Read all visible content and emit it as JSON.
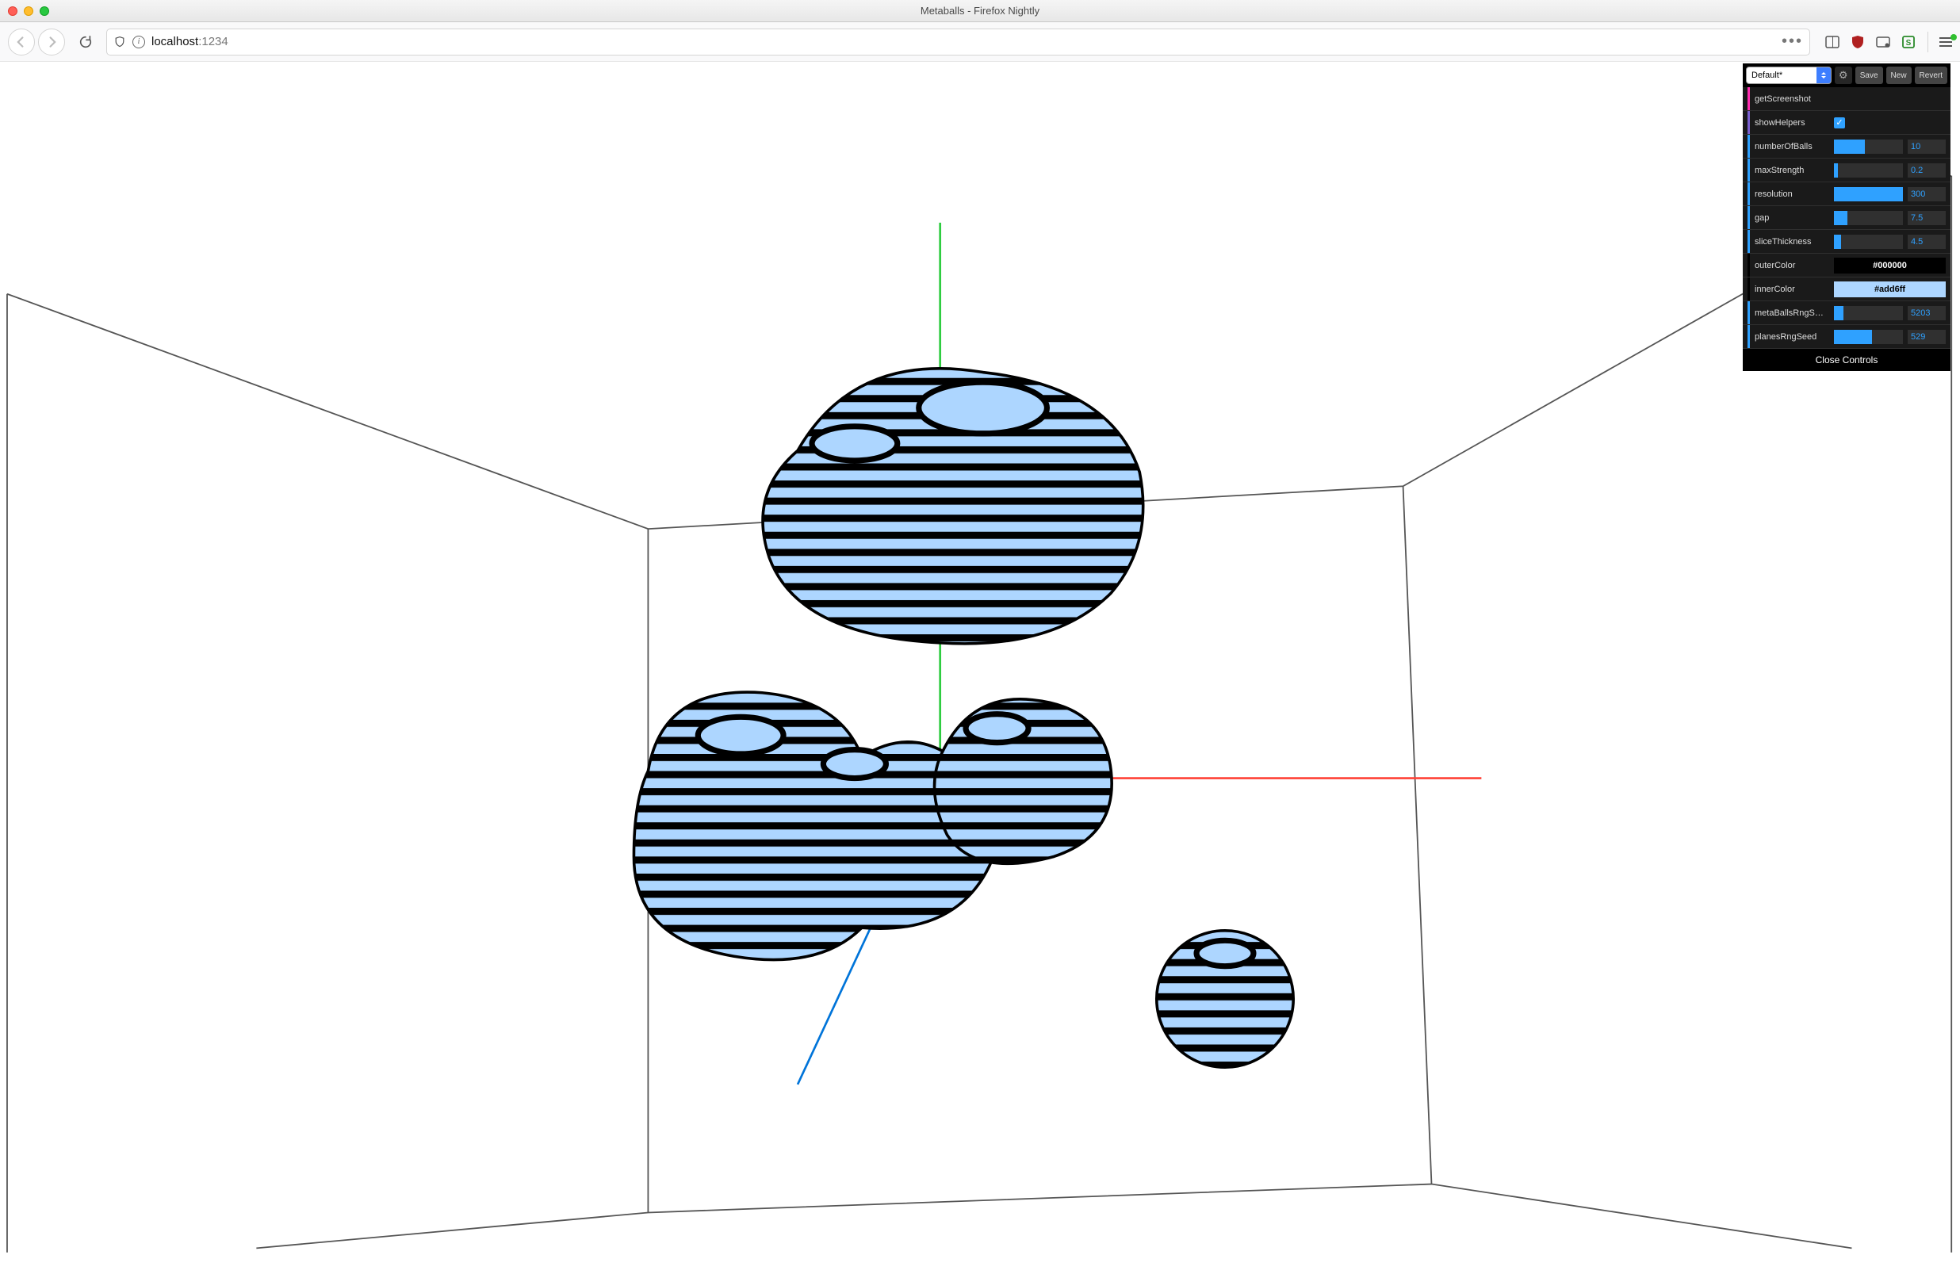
{
  "window": {
    "title": "Metaballs - Firefox Nightly"
  },
  "url": {
    "prefix": "localhost",
    "port": ":1234"
  },
  "gui": {
    "preset": "Default*",
    "buttons": {
      "save": "Save",
      "new": "New",
      "revert": "Revert"
    },
    "rows": {
      "getScreenshot": "getScreenshot",
      "showHelpers": {
        "label": "showHelpers",
        "checked": true
      },
      "numberOfBalls": {
        "label": "numberOfBalls",
        "value": "10",
        "fill": 0.45
      },
      "maxStrength": {
        "label": "maxStrength",
        "value": "0.2",
        "fill": 0.06
      },
      "resolution": {
        "label": "resolution",
        "value": "300",
        "fill": 1.0
      },
      "gap": {
        "label": "gap",
        "value": "7.5",
        "fill": 0.2
      },
      "sliceThickness": {
        "label": "sliceThickness",
        "value": "4.5",
        "fill": 0.1
      },
      "outerColor": {
        "label": "outerColor",
        "value": "#000000",
        "bg": "#000000",
        "fg": "#ffffff"
      },
      "innerColor": {
        "label": "innerColor",
        "value": "#add6ff",
        "bg": "#add6ff",
        "fg": "#000000"
      },
      "metaBallsRngSeed": {
        "label": "metaBallsRngS…",
        "value": "5203",
        "fill": 0.14
      },
      "planesRngSeed": {
        "label": "planesRngSeed",
        "value": "529",
        "fill": 0.55
      }
    },
    "close": "Close Controls"
  }
}
